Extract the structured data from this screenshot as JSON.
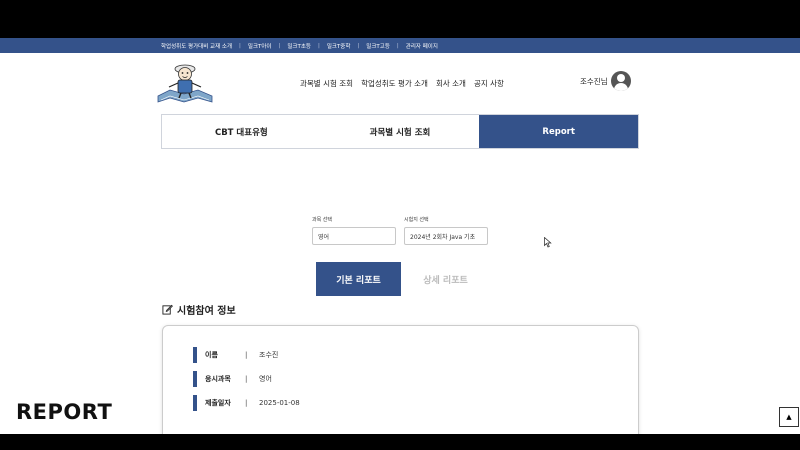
{
  "topbar": {
    "links": [
      "학업성취도 평가대비 교재 소개",
      "밀크T아이",
      "밀크T초등",
      "밀크T중학",
      "밀크T고등",
      "관리자 페이지"
    ]
  },
  "header": {
    "nav": [
      "과목별 시험 조회",
      "학업성취도 평가 소개",
      "회사 소개",
      "공지 사항"
    ],
    "user_name": "조수진님"
  },
  "tabs": [
    "CBT 대표유형",
    "과목별 시험 조회",
    "Report"
  ],
  "active_tab": "Report",
  "filters": {
    "subject_label": "과목 선택",
    "subject_value": "영어",
    "exam_label": "시험지 선택",
    "exam_value": "2024년 2회차 Java 기초"
  },
  "report_buttons": {
    "basic": "기본 리포트",
    "detail": "상세 리포트"
  },
  "section": {
    "title": "시험참여 정보"
  },
  "info": [
    {
      "label": "이름",
      "value": "조수진"
    },
    {
      "label": "응시과목",
      "value": "영어"
    },
    {
      "label": "제출일자",
      "value": "2025-01-08"
    }
  ],
  "overlay_caption": "REPORT",
  "scroll_top_icon": "▲",
  "colors": {
    "primary": "#34528a",
    "background": "#ffffff",
    "border": "#d0d4dc"
  }
}
